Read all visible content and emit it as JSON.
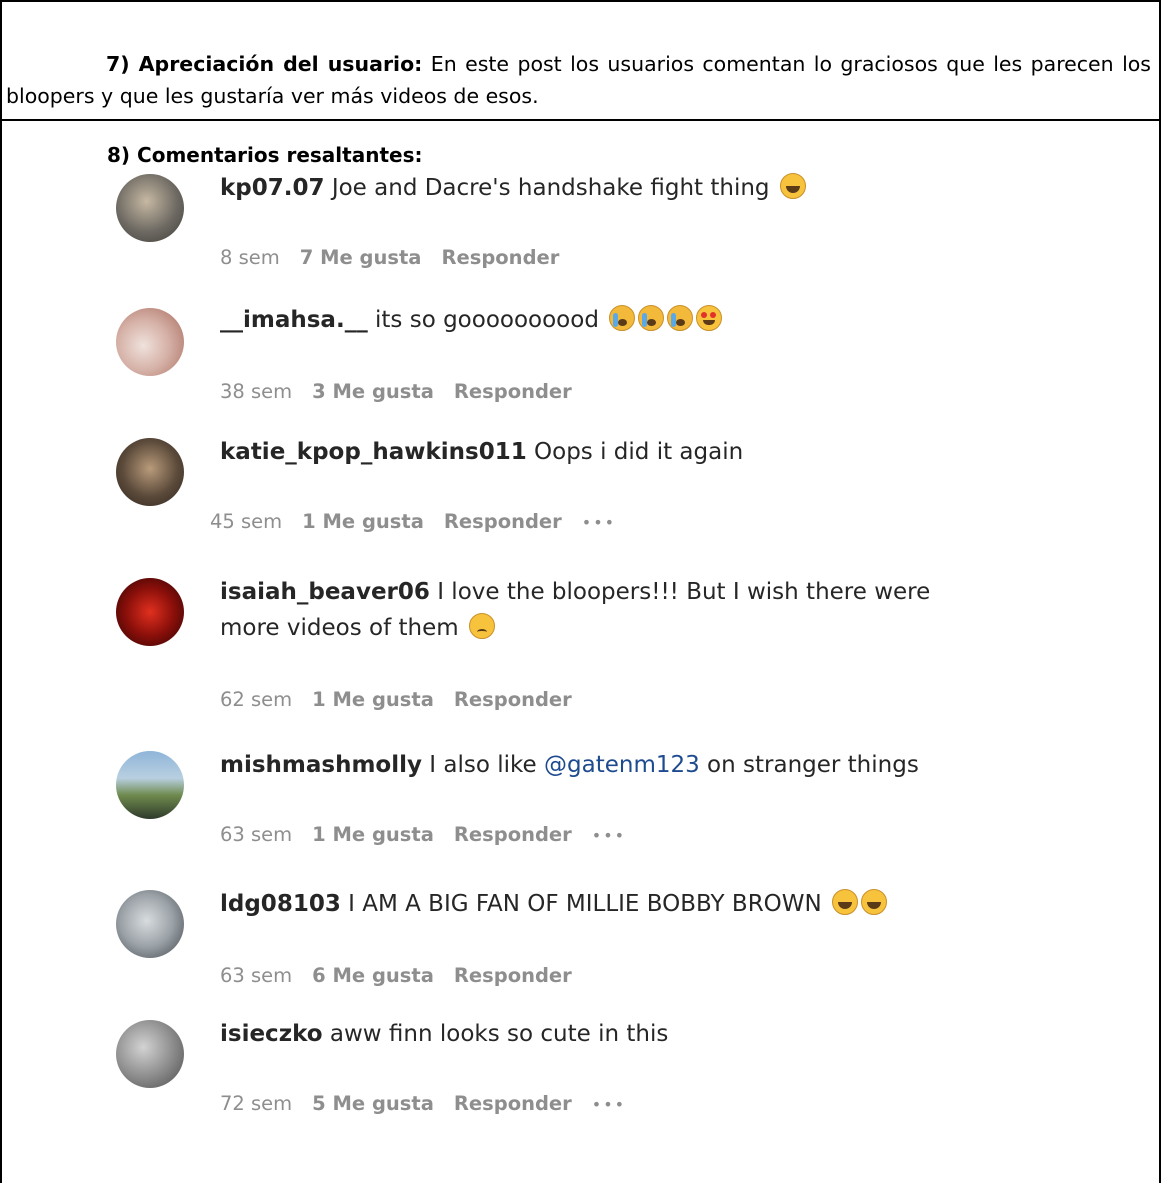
{
  "section7": {
    "heading": "7) Apreciación del usuario:",
    "body": " En este post los usuarios comentan lo graciosos que les parecen los bloopers y que les gustaría ver más videos de esos."
  },
  "section8": {
    "heading": "8) Comentarios resaltantes:"
  },
  "comments": [
    {
      "user": "kp07.07",
      "text": " Joe and Dacre's handshake fight thing",
      "age": "8 sem",
      "likes": "7 Me gusta",
      "reply": "Responder",
      "emoji": "grinning-squint-emoji",
      "avatar_colors": [
        "#6e6a63",
        "#c7b9a3",
        "#3d3a36"
      ]
    },
    {
      "user": "__imahsa.__",
      "text": " its so goooooooood",
      "age": "38 sem",
      "likes": "3 Me gusta",
      "reply": "Responder",
      "emoji": "loudly-crying-emoji x3, heart-eyes-emoji",
      "avatar_colors": [
        "#d6b2a8",
        "#a86a5c",
        "#efe2dc"
      ]
    },
    {
      "user": "katie_kpop_hawkins011",
      "text": " Oops i did it again",
      "age": "45 sem",
      "likes": "1 Me gusta",
      "reply": "Responder",
      "more": "•••",
      "avatar_colors": [
        "#5b4a3a",
        "#b99b7b",
        "#2c241d"
      ]
    },
    {
      "user": "isaiah_beaver06",
      "text": " I love the bloopers!!! But I wish there were more videos of them",
      "age": "62 sem",
      "likes": "1 Me gusta",
      "reply": "Responder",
      "emoji": "worried-emoji",
      "avatar_colors": [
        "#8a0f0a",
        "#e0301f",
        "#2a0303"
      ]
    },
    {
      "user": "mishmashmolly",
      "text": " I also like ",
      "mention": "@gatenm123",
      "text_after": " on stranger things",
      "age": "63 sem",
      "likes": "1 Me gusta",
      "reply": "Responder",
      "more": "•••",
      "avatar_colors": [
        "#8fb5d9",
        "#6f8a4e",
        "#2e3a2a"
      ]
    },
    {
      "user": "ldg08103",
      "text": " I AM A BIG FAN OF MILLIE BOBBY BROWN",
      "age": "63 sem",
      "likes": "6 Me gusta",
      "reply": "Responder",
      "emoji": "grinning-squint-emoji x2",
      "avatar_colors": [
        "#9aa1a6",
        "#d8dcdf",
        "#3d4348"
      ]
    },
    {
      "user": "isieczko",
      "text": " aww finn looks so cute in this",
      "age": "72 sem",
      "likes": "5 Me gusta",
      "reply": "Responder",
      "more": "•••",
      "avatar_colors": [
        "#8f8f8f",
        "#d3d3d3",
        "#4a4a4a"
      ]
    }
  ]
}
